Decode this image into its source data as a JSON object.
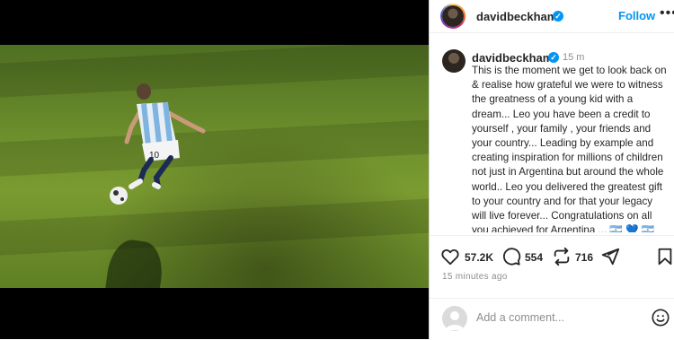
{
  "post": {
    "username": "davidbeckham",
    "follow_label": "Follow",
    "more_label": "•••",
    "caption_time": "15 m",
    "caption": "This is the moment we get to look back on & realise how grateful we were to witness the greatness of a young kid with a dream... Leo you have been a credit to yourself , your family , your friends and your country... Leading by example and creating inspiration for millions of children not just in Argentina but around the whole world.. Leo you delivered the greatest gift to your country and for that your legacy will live forever... Congratulations on all you achieved for Argentina ... 🇦🇷 💙 🇦🇷 Enjoy",
    "likes": "57.2K",
    "comments": "554",
    "reposts": "716",
    "time_ago": "15 minutes ago",
    "comment_placeholder": "Add a comment...",
    "photo_jersey_number": "10"
  },
  "icons": {
    "verified": "verified-badge",
    "like": "heart-icon",
    "comment": "comment-bubble-icon",
    "repost": "repost-icon",
    "share": "send-icon",
    "save": "bookmark-icon",
    "emoji": "emoji-icon"
  },
  "colors": {
    "accent": "#0095f6",
    "text": "#262626",
    "muted": "#8e8e8e"
  }
}
